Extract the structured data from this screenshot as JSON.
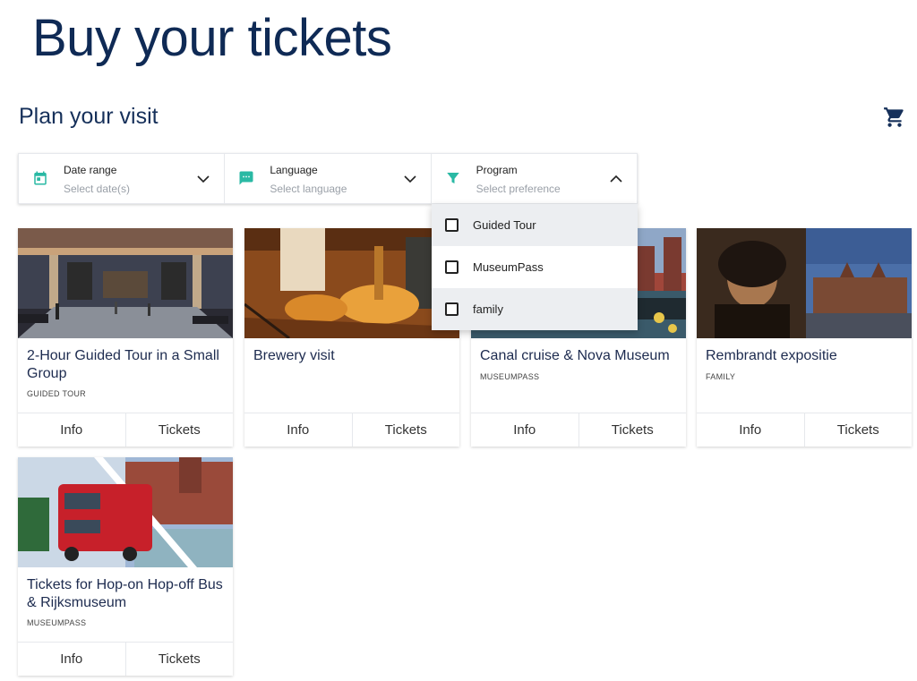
{
  "page": {
    "title": "Buy your tickets",
    "section_title": "Plan your visit"
  },
  "icons": {
    "cart": "cart-icon",
    "date": "calendar-icon",
    "language": "chat-icon",
    "program": "filter-icon"
  },
  "colors": {
    "primary": "#0f2a55",
    "accent": "#2ab9a4"
  },
  "filters": {
    "date": {
      "label": "Date range",
      "placeholder": "Select date(s)"
    },
    "language": {
      "label": "Language",
      "placeholder": "Select language"
    },
    "program": {
      "label": "Program",
      "placeholder": "Select preference",
      "expanded": true
    }
  },
  "program_options": [
    {
      "label": "Guided Tour",
      "checked": false
    },
    {
      "label": "MuseumPass",
      "checked": false
    },
    {
      "label": "family",
      "checked": false
    }
  ],
  "cards": [
    {
      "title": "2-Hour Guided Tour in a Small Group",
      "tag": "GUIDED TOUR",
      "info": "Info",
      "tickets": "Tickets"
    },
    {
      "title": "Brewery visit",
      "tag": "",
      "info": "Info",
      "tickets": "Tickets"
    },
    {
      "title": "Canal cruise & Nova Museum",
      "tag": "MUSEUMPASS",
      "info": "Info",
      "tickets": "Tickets"
    },
    {
      "title": "Rembrandt expositie",
      "tag": "FAMILY",
      "info": "Info",
      "tickets": "Tickets"
    },
    {
      "title": "Tickets for Hop-on Hop-off Bus & Rijksmuseum",
      "tag": "MUSEUMPASS",
      "info": "Info",
      "tickets": "Tickets"
    }
  ]
}
